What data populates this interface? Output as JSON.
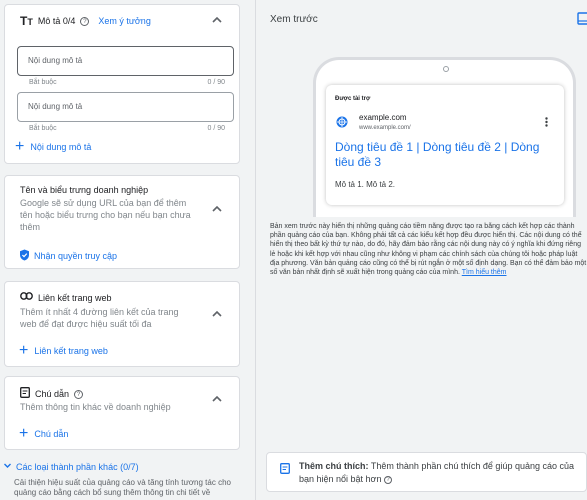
{
  "desc_section": {
    "title": "Mô tả 0/4",
    "idea_link": "Xem ý tưởng",
    "fields": [
      {
        "placeholder": "Nội dung mô tả",
        "required": "Bắt buộc",
        "count": "0 / 90"
      },
      {
        "placeholder": "Nội dung mô tả",
        "required": "Bắt buộc",
        "count": "0 / 90"
      }
    ],
    "add_label": "Nội dung mô tả"
  },
  "business_section": {
    "title": "Tên và biểu trưng doanh nghiệp",
    "desc": "Google sẽ sử dụng URL của bạn để thêm tên hoặc biểu trưng cho bạn nếu bạn chưa thêm",
    "access_label": "Nhận quyền truy cập"
  },
  "sitelink_section": {
    "title": "Liên kết trang web",
    "desc": "Thêm ít nhất 4 đường liên kết của trang web để đạt được hiệu suất tối đa",
    "add_label": "Liên kết trang web"
  },
  "callout_section": {
    "title": "Chú dẫn",
    "desc": "Thêm thông tin khác về doanh nghiệp",
    "add_label": "Chú dẫn"
  },
  "other_assets": {
    "title": "Các loại thành phần khác (0/7)",
    "desc": "Cải thiện hiệu suất của quảng cáo và tăng tính tương tác cho quảng cáo bằng cách bổ sung thêm thông tin chi tiết về"
  },
  "preview": {
    "title": "Xem trước",
    "sponsored": "Được tài trợ",
    "site_name": "example.com",
    "site_url": "www.example.com/",
    "headline": "Dòng tiêu đề 1 | Dòng tiêu đề 2 | Dòng tiêu đề 3",
    "description": "Mô tả 1. Mô tả 2.",
    "disclaimer": "Bản xem trước này hiển thị những quảng cáo tiềm năng được tạo ra bằng cách kết hợp các thành phần quảng cáo của bạn. Không phải tất cả các kiểu kết hợp đều được hiển thị. Các nội dung có thể hiển thị theo bất kỳ thứ tự nào, do đó, hãy đảm bảo rằng các nội dung này có ý nghĩa khi đứng riêng lẻ hoặc khi kết hợp với nhau cũng như không vi phạm các chính sách của chúng tôi hoặc pháp luật địa phương. Văn bản quảng cáo cũng có thể bị rút ngắn ở một số định dạng. Bạn có thể đảm bảo một số văn bản nhất định sẽ xuất hiện trong quảng cáo của mình.",
    "learn_more": "Tìm hiểu thêm",
    "callout_tip_bold": "Thêm chú thích:",
    "callout_tip_text": "Thêm thành phần chú thích để giúp quảng cáo của bạn hiện nổi bật hơn"
  },
  "colors": {
    "accent": "#1a73e8",
    "muted": "#80868b"
  }
}
